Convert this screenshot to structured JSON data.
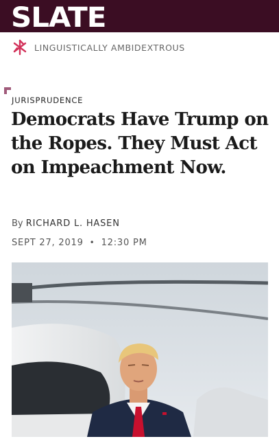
{
  "masthead": {
    "logo_text": "SLATE",
    "tagline": "LINGUISTICALLY AMBIDEXTROUS"
  },
  "article": {
    "section": "JURISPRUDENCE",
    "headline": "Democrats Have Trump on the Ropes. They Must Act on Impeachment Now.",
    "byline_prefix": "By",
    "author": "RICHARD L. HASEN",
    "date": "SEPT 27, 2019",
    "time": "12:30 PM",
    "date_separator": "•"
  },
  "colors": {
    "masthead_bg": "#3b0d23",
    "accent": "#d2325a"
  },
  "icons": {
    "tagline_icon": "slate-pinwheel-icon",
    "section_marker": "corner-marker-icon"
  }
}
